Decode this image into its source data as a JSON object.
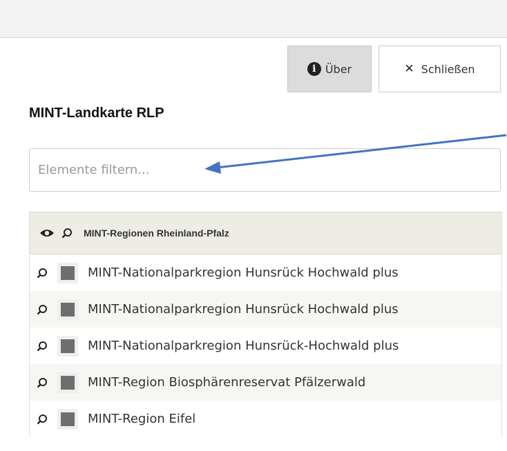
{
  "toolbar": {
    "about_label": "Über",
    "close_label": "Schließen"
  },
  "panel": {
    "title": "MINT-Landkarte RLP",
    "filter_placeholder": "Elemente filtern..."
  },
  "group": {
    "label": "MINT-Regionen Rheinland-Pfalz"
  },
  "items": [
    {
      "label": "MINT-Nationalparkregion Hunsrück Hochwald plus"
    },
    {
      "label": "MINT-Nationalparkregion Hunsrück Hochwald plus"
    },
    {
      "label": "MINT-Nationalparkregion Hunsrück-Hochwald plus"
    },
    {
      "label": "MINT-Region Biosphärenreservat Pfälzerwald"
    },
    {
      "label": "MINT-Region Eifel"
    }
  ],
  "colors": {
    "arrow": "#4472c4",
    "header_bg": "#eeede4",
    "about_bg": "#dcdcdc"
  },
  "icons": [
    "info-icon",
    "close-icon",
    "eye-icon",
    "zoom-icon",
    "layer-thumbnail"
  ]
}
